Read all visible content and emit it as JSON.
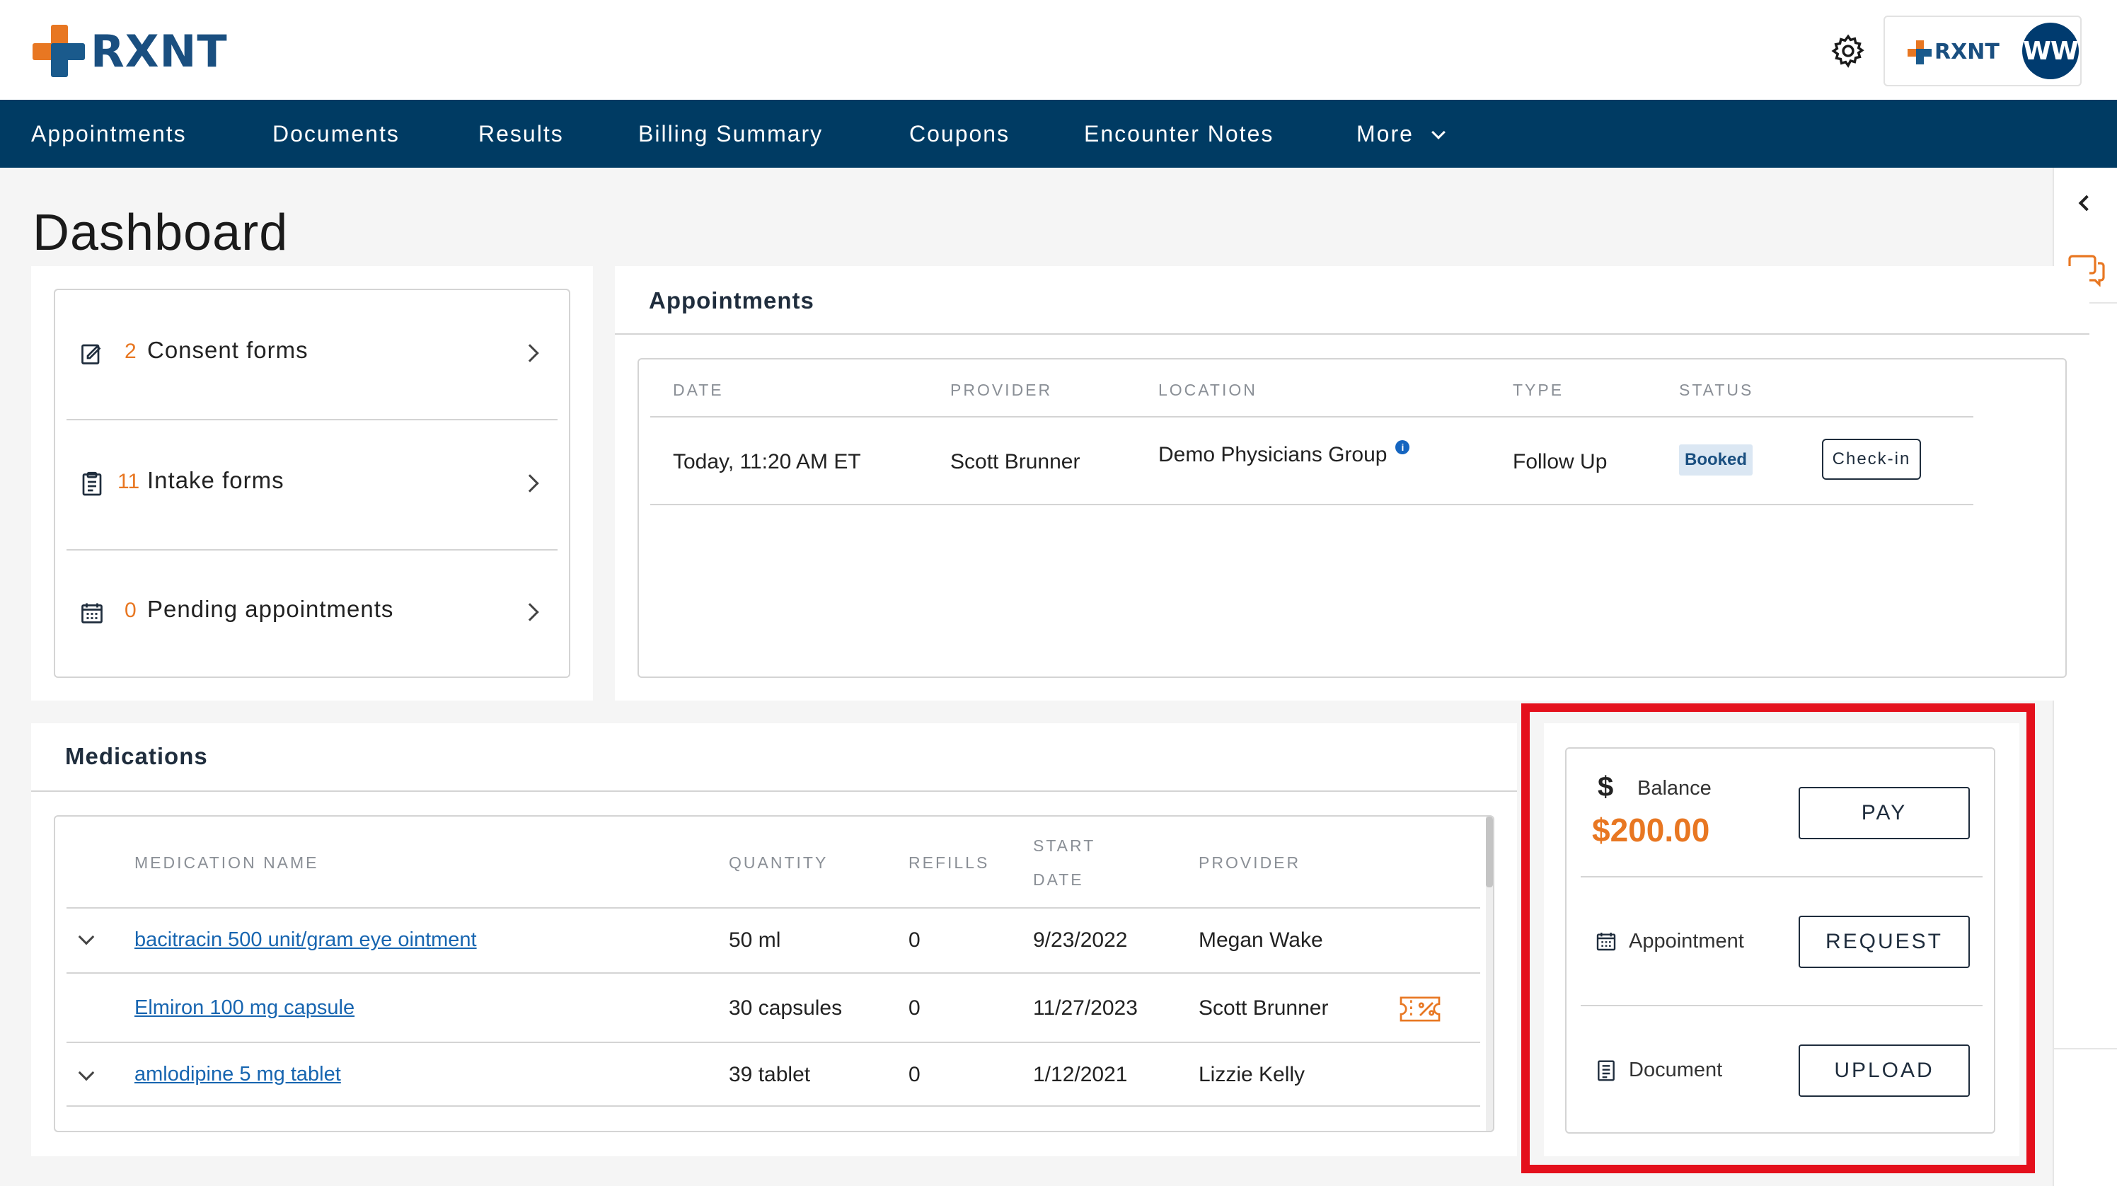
{
  "header": {
    "logo_text": "RXNT",
    "brand_text": "RXNT",
    "avatar_initials": "WW"
  },
  "nav": {
    "items": [
      "Appointments",
      "Documents",
      "Results",
      "Billing Summary",
      "Coupons",
      "Encounter Notes",
      "More"
    ]
  },
  "page": {
    "title": "Dashboard"
  },
  "forms": [
    {
      "count": "2",
      "label": "Consent forms",
      "icon": "form-edit-icon"
    },
    {
      "count": "11",
      "label": "Intake forms",
      "icon": "clipboard-icon"
    },
    {
      "count": "0",
      "label": "Pending appointments",
      "icon": "calendar-icon"
    }
  ],
  "appointments": {
    "title": "Appointments",
    "headers": [
      "DATE",
      "PROVIDER",
      "LOCATION",
      "TYPE",
      "STATUS"
    ],
    "rows": [
      {
        "date": "Today, 11:20 AM ET",
        "provider": "Scott Brunner",
        "location": "Demo Physicians Group",
        "type": "Follow Up",
        "status": "Booked",
        "action": "Check-in"
      }
    ]
  },
  "medications": {
    "title": "Medications",
    "headers": {
      "name": "MEDICATION NAME",
      "quantity": "QUANTITY",
      "refills": "REFILLS",
      "start_1": "START",
      "start_2": "DATE",
      "provider": "PROVIDER"
    },
    "rows": [
      {
        "name": "bacitracin 500 unit/gram eye ointment",
        "quantity": "50 ml",
        "refills": "0",
        "start": "9/23/2022",
        "provider": "Megan Wake",
        "expandable": true,
        "coupon": false
      },
      {
        "name": "Elmiron 100 mg capsule",
        "quantity": "30 capsules",
        "refills": "0",
        "start": "11/27/2023",
        "provider": "Scott Brunner",
        "expandable": false,
        "coupon": true
      },
      {
        "name": "amlodipine 5 mg tablet",
        "quantity": "39 tablet",
        "refills": "0",
        "start": "1/12/2021",
        "provider": "Lizzie Kelly",
        "expandable": true,
        "coupon": false
      }
    ]
  },
  "actions": {
    "balance_label": "Balance",
    "balance_value": "$200.00",
    "currency_symbol": "$",
    "pay_label": "PAY",
    "appointment_label": "Appointment",
    "request_label": "REQUEST",
    "document_label": "Document",
    "upload_label": "UPLOAD"
  },
  "colors": {
    "brand_navy": "#003b63",
    "accent_orange": "#e87722",
    "link_blue": "#1765b0",
    "highlight_red": "#e4101c"
  }
}
